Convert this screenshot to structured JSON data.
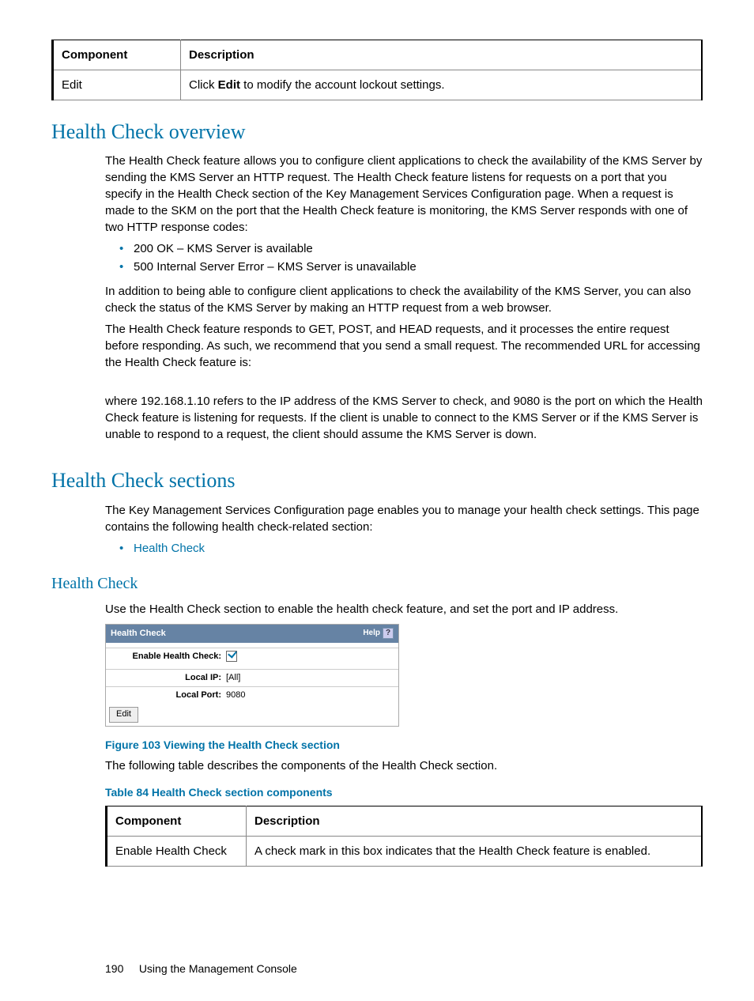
{
  "topTable": {
    "headers": {
      "component": "Component",
      "description": "Description"
    },
    "row": {
      "component": "Edit",
      "desc_pre": "Click ",
      "desc_bold": "Edit",
      "desc_post": " to modify the account lockout settings."
    }
  },
  "overview": {
    "heading": "Health Check overview",
    "para1": "The Health Check feature allows you to configure client applications to check the availability of the KMS Server by sending the KMS Server an HTTP request. The Health Check feature listens for requests on a port that you specify in the Health Check section of the Key Management Services Configuration page. When a request is made to the SKM on the port that the Health Check feature is monitoring, the KMS Server responds with one of two HTTP response codes:",
    "bullets": [
      "200 OK – KMS Server is available",
      "500 Internal Server Error – KMS Server is unavailable"
    ],
    "para2": "In addition to being able to configure client applications to check the availability of the KMS Server, you can also check the status of the KMS Server by making an HTTP request from a web browser.",
    "para3": "The Health Check feature responds to GET, POST, and HEAD requests, and it processes the entire request before responding. As such, we recommend that you send a small request. The recommended URL for accessing the Health Check feature is:",
    "para4": "where 192.168.1.10 refers to the IP address of the KMS Server to check, and 9080 is the port on which the Health Check feature is listening for requests. If the client is unable to connect to the KMS Server or if the KMS Server is unable to respond to a request, the client should assume the KMS Server is down."
  },
  "sections": {
    "heading": "Health Check sections",
    "para": "The Key Management Services Configuration page enables you to manage your health check settings. This page contains the following health check-related section:",
    "link": "Health Check"
  },
  "healthCheck": {
    "heading": "Health Check",
    "para": "Use the Health Check section to enable the health check feature, and set the port and IP address.",
    "widget": {
      "title": "Health Check",
      "help": "Help",
      "rows": {
        "enable": {
          "label": "Enable Health Check:",
          "value": "checked"
        },
        "localIp": {
          "label": "Local IP:",
          "value": "[All]"
        },
        "localPort": {
          "label": "Local Port:",
          "value": "9080"
        }
      },
      "editBtn": "Edit"
    },
    "figureCaption": "Figure 103 Viewing the Health Check section",
    "tableIntro": "The following table describes the components of the Health Check section.",
    "tableCaption": "Table 84 Health Check section components",
    "table": {
      "headers": {
        "component": "Component",
        "description": "Description"
      },
      "rows": [
        {
          "component": "Enable Health Check",
          "description": "A check mark in this box indicates that the Health Check feature is enabled."
        }
      ]
    }
  },
  "footer": {
    "page": "190",
    "text": "Using the Management Console"
  }
}
